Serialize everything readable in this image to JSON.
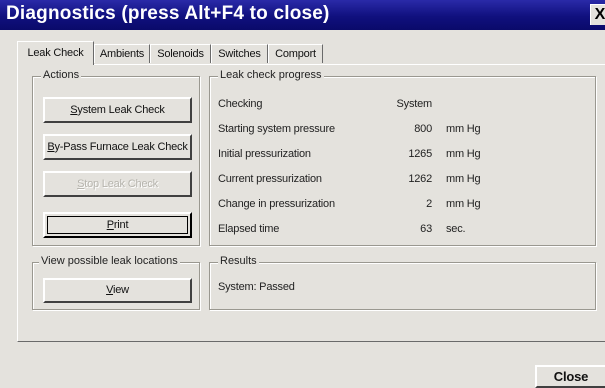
{
  "window": {
    "title": "Diagnostics  (press Alt+F4 to close)",
    "close_glyph": "X"
  },
  "tabs": [
    {
      "label": "Leak Check",
      "active": true
    },
    {
      "label": "Ambients",
      "active": false
    },
    {
      "label": "Solenoids",
      "active": false
    },
    {
      "label": "Switches",
      "active": false
    },
    {
      "label": "Comport",
      "active": false
    }
  ],
  "actions": {
    "group_label": "Actions",
    "system_leak_check": {
      "pre": "",
      "u": "S",
      "post": "ystem Leak Check"
    },
    "bypass_leak_check": {
      "pre": "",
      "u": "B",
      "post": "y-Pass Furnace Leak Check"
    },
    "stop_leak_check": {
      "pre": "",
      "u": "S",
      "post": "top Leak Check"
    },
    "print": {
      "pre": "",
      "u": "P",
      "post": "rint"
    }
  },
  "locations": {
    "group_label": "View possible leak locations",
    "view": {
      "pre": "",
      "u": "V",
      "post": "iew"
    }
  },
  "progress": {
    "group_label": "Leak check progress",
    "rows": [
      {
        "label": "Checking",
        "value": "System",
        "unit": ""
      },
      {
        "label": "Starting system pressure",
        "value": "800",
        "unit": "mm Hg"
      },
      {
        "label": "Initial pressurization",
        "value": "1265",
        "unit": "mm Hg"
      },
      {
        "label": "Current pressurization",
        "value": "1262",
        "unit": "mm Hg"
      },
      {
        "label": "Change in pressurization",
        "value": "2",
        "unit": "mm Hg"
      },
      {
        "label": "Elapsed time",
        "value": "63",
        "unit": "sec."
      }
    ]
  },
  "results": {
    "group_label": "Results",
    "text": "System: Passed"
  },
  "footer": {
    "close_label": "Close"
  }
}
